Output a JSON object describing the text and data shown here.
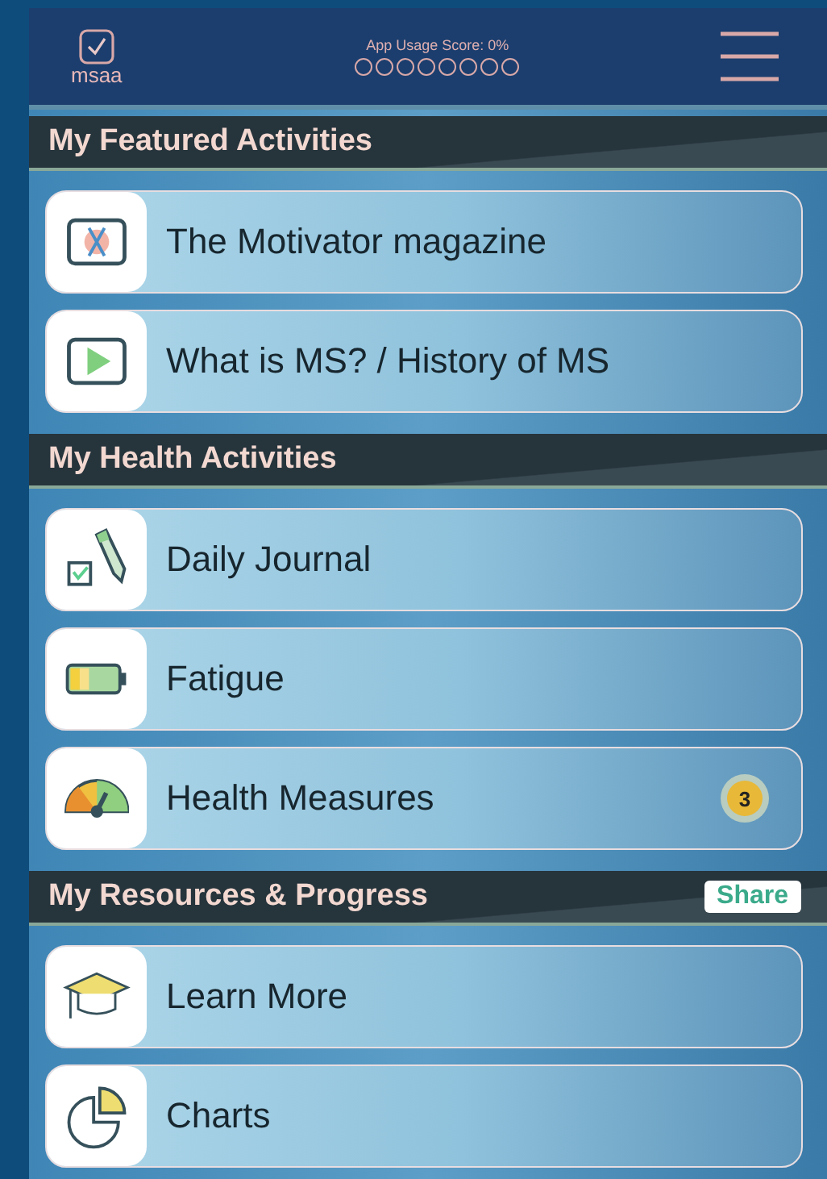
{
  "header": {
    "logo_text": "msaa",
    "score_label": "App Usage Score: 0%",
    "score_steps": [
      {
        "filled": false
      },
      {
        "filled": false
      },
      {
        "filled": false
      },
      {
        "filled": false
      },
      {
        "filled": false
      },
      {
        "filled": false
      },
      {
        "filled": false
      },
      {
        "filled": false
      }
    ]
  },
  "sections": [
    {
      "title": "My Featured Activities",
      "items": [
        {
          "kind": "magazine",
          "label": "The Motivator magazine"
        },
        {
          "kind": "video",
          "label": "What is MS? / History of MS"
        }
      ]
    },
    {
      "title": "My Health Activities",
      "items": [
        {
          "kind": "journal",
          "label": "Daily Journal"
        },
        {
          "kind": "battery",
          "label": "Fatigue"
        },
        {
          "kind": "gauge",
          "label": "Health Measures",
          "badge": "3"
        }
      ]
    },
    {
      "title": "My Resources & Progress",
      "action": "Share",
      "items": [
        {
          "kind": "graduation",
          "label": "Learn More"
        },
        {
          "kind": "piechart",
          "label": "Charts"
        }
      ]
    }
  ]
}
